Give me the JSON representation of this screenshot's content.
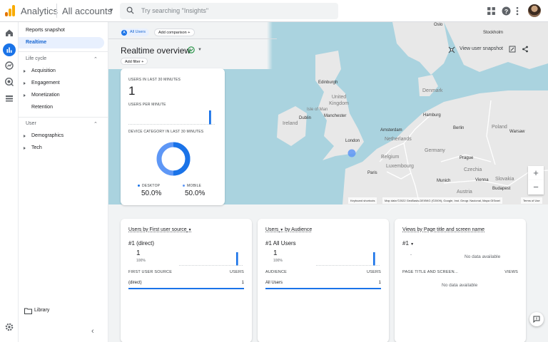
{
  "header": {
    "app_name": "Analytics",
    "account": "All accounts",
    "search_placeholder": "Try searching \"Insights\""
  },
  "sidebar": {
    "top_items": [
      "Reports snapshot",
      "Realtime"
    ],
    "sections": [
      {
        "title": "Life cycle",
        "items": [
          "Acquisition",
          "Engagement",
          "Monetization",
          "Retention"
        ]
      },
      {
        "title": "User",
        "items": [
          "Demographics",
          "Tech"
        ]
      }
    ],
    "library": "Library"
  },
  "toolbar": {
    "segment_badge": "A",
    "segment": "All Users",
    "add_comparison": "Add comparison",
    "title": "Realtime overview",
    "add_filter": "Add filter",
    "view_snapshot": "View user snapshot"
  },
  "map": {
    "cities": [
      "Oslo",
      "Stockholm",
      "Edinburgh",
      "Dublin",
      "Manchester",
      "London",
      "Hamburg",
      "Amsterdam",
      "Berlin",
      "Warsaw",
      "Paris",
      "Prague",
      "Munich",
      "Vienna",
      "Budapest"
    ],
    "countries": [
      "Denmark",
      "United Kingdom",
      "Isle of Man",
      "Ireland",
      "Netherlands",
      "Poland",
      "Belgium",
      "Germany",
      "Luxembourg",
      "Czechia",
      "Slovakia",
      "Austria"
    ],
    "footer_shortcuts": "Keyboard shortcuts",
    "footer_attr": "Map data ©2022 GeoBasis-DE/BKG (©2009), Google, Inst. Geogr. Nacional, Mapa GISrael",
    "footer_terms": "Terms of Use"
  },
  "realtime": {
    "users_label": "USERS IN LAST 30 MINUTES",
    "users_value": "1",
    "per_minute_label": "USERS PER MINUTE",
    "device_label": "DEVICE CATEGORY IN LAST 30 MINUTES",
    "desktop_label": "DESKTOP",
    "desktop_value": "50.0%",
    "mobile_label": "MOBILE",
    "mobile_value": "50.0%",
    "desktop_share": 0.5
  },
  "cards": [
    {
      "title": "Users by First user source",
      "sub": "#1  (direct)",
      "value": "1",
      "pct": "100%",
      "col1": "FIRST USER SOURCE",
      "col2": "USERS",
      "row_label": "(direct)",
      "row_value": "1"
    },
    {
      "title_a": "Users",
      "title_b": "by Audience",
      "sub": "#1  All Users",
      "value": "1",
      "pct": "100%",
      "col1": "AUDIENCE",
      "col2": "USERS",
      "row_label": "All Users",
      "row_value": "1"
    },
    {
      "title": "Views by Page title and screen name",
      "sub": "#1",
      "dash": "-",
      "nodata1": "No data available",
      "col1": "PAGE TITLE AND SCREEN...",
      "col2": "VIEWS",
      "nodata2": "No data available"
    }
  ],
  "colors": {
    "accent": "#1a73e8",
    "desktop": "#1a73e8",
    "mobile": "#5e97f6"
  }
}
